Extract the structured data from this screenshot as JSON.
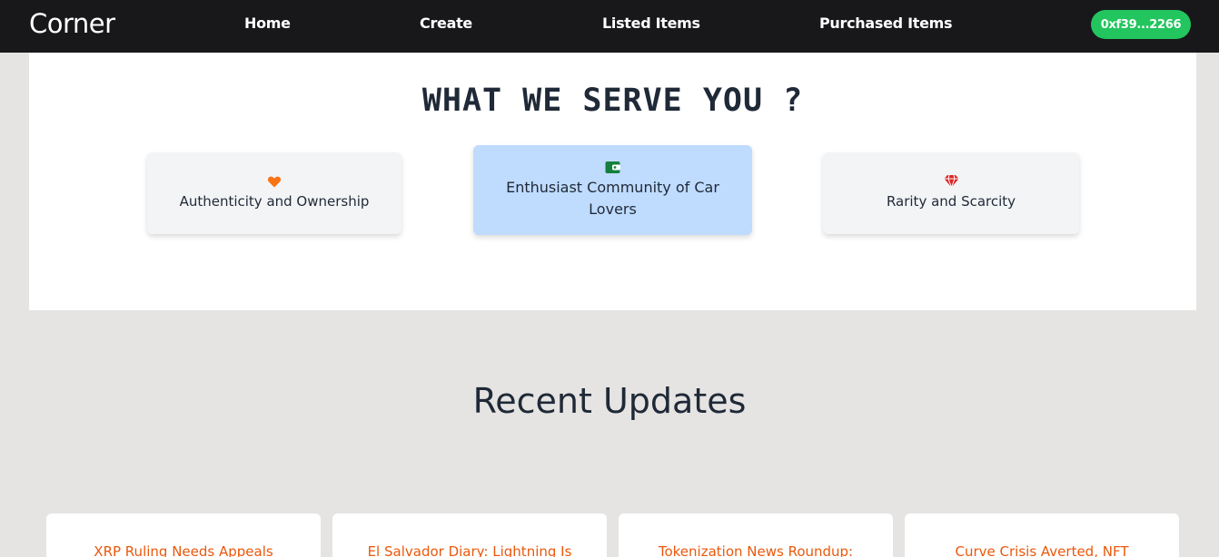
{
  "nav": {
    "brand": "Corner",
    "links": [
      "Home",
      "Create",
      "Listed Items",
      "Purchased Items"
    ],
    "wallet": "0xf39...2266"
  },
  "serve": {
    "title": "WHAT WE SERVE YOU ?",
    "features": [
      {
        "label": "Authenticity and Ownership",
        "icon": "heart-icon",
        "color": "#f97316"
      },
      {
        "label": "Enthusiast Community of Car Lovers",
        "icon": "wallet-icon",
        "color": "#15803d"
      },
      {
        "label": "Rarity and Scarcity",
        "icon": "diamond-icon",
        "color": "#dc2626"
      }
    ]
  },
  "updates": {
    "title": "Recent Updates",
    "items": [
      "XRP Ruling Needs Appeals",
      "El Salvador Diary: Lightning Is",
      "Tokenization News Roundup:",
      "Curve Crisis Averted, NFT"
    ]
  },
  "colors": {
    "nav_bg": "#18181b",
    "wallet_btn": "#22c55e",
    "accent_link": "#ea580c",
    "highlight_card": "#bfdbfe"
  }
}
